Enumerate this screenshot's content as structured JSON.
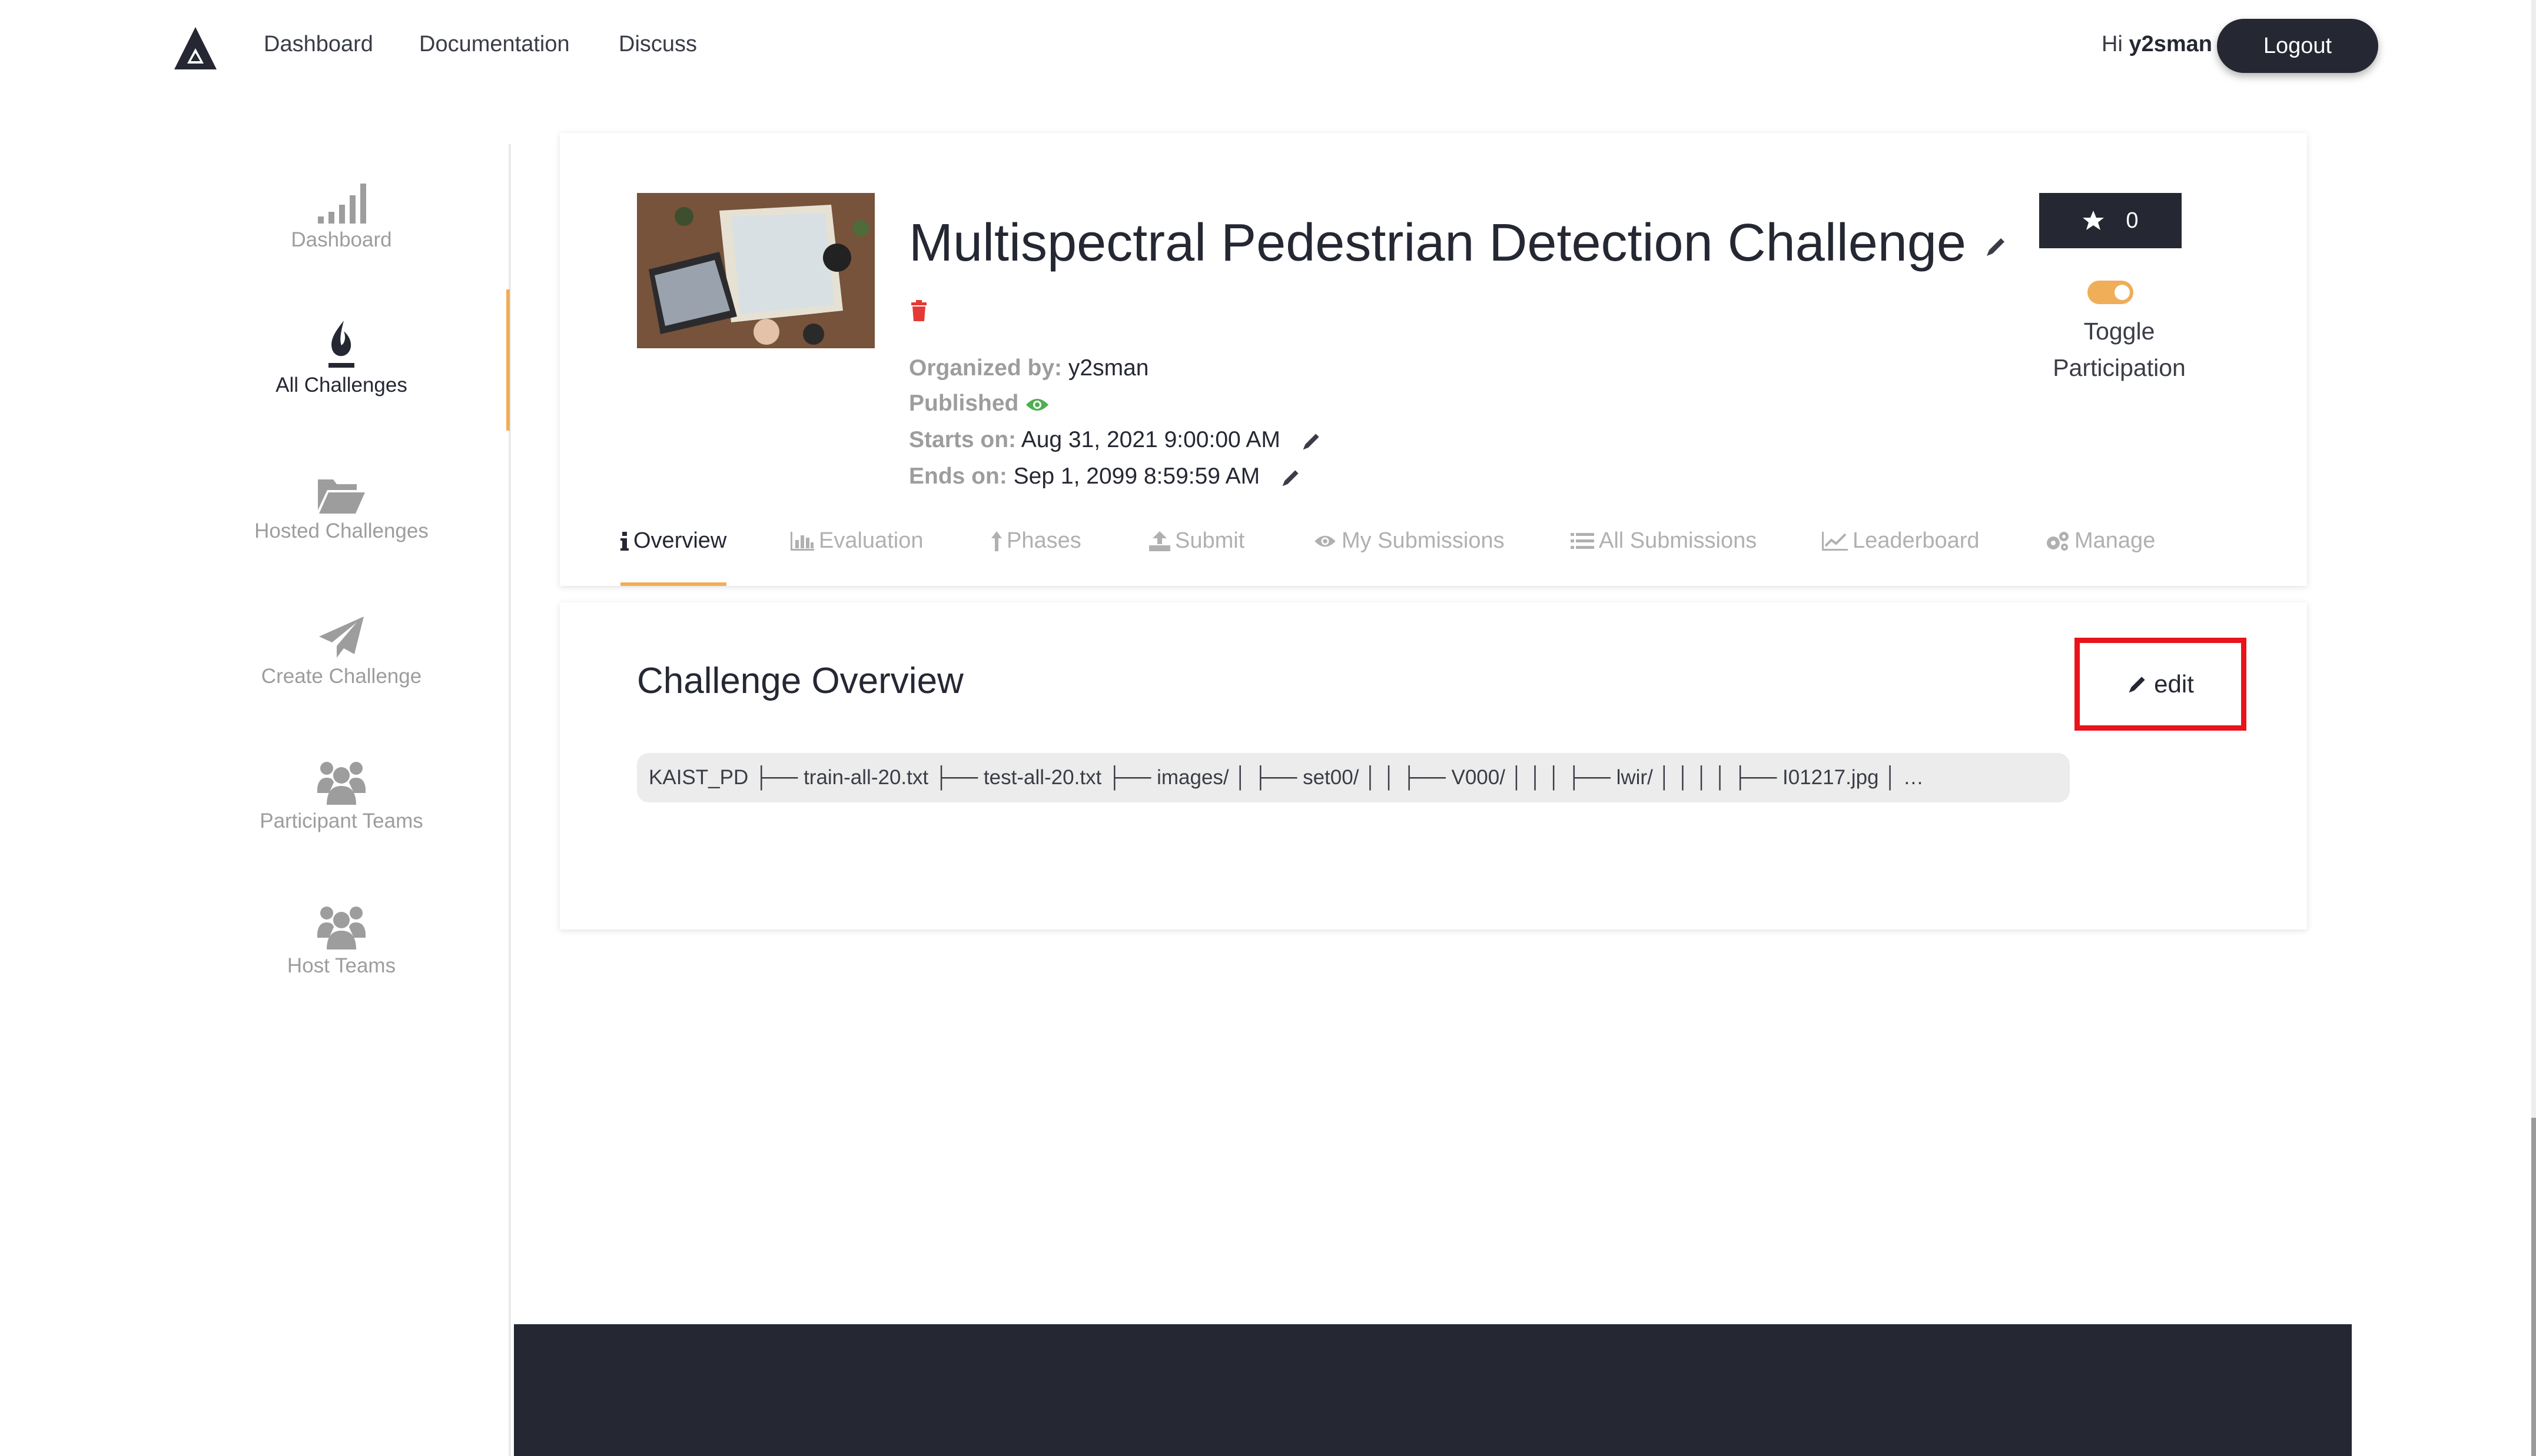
{
  "nav": {
    "links": [
      "Dashboard",
      "Documentation",
      "Discuss"
    ],
    "greeting_prefix": "Hi",
    "username": "y2sman",
    "logout_label": "Logout"
  },
  "sidebar": {
    "items": [
      {
        "label": "Dashboard",
        "icon": "bar-signal-icon",
        "active": false
      },
      {
        "label": "All Challenges",
        "icon": "flame-icon",
        "active": true
      },
      {
        "label": "Hosted Challenges",
        "icon": "folder-open-icon",
        "active": false
      },
      {
        "label": "Create Challenge",
        "icon": "paper-plane-icon",
        "active": false
      },
      {
        "label": "Participant Teams",
        "icon": "users-icon",
        "active": false
      },
      {
        "label": "Host Teams",
        "icon": "users-icon",
        "active": false
      }
    ]
  },
  "challenge": {
    "title": "Multispectral Pedestrian Detection Challenge",
    "organized_label": "Organized by:",
    "organizer": "y2sman",
    "published_label": "Published",
    "starts_label": "Starts on:",
    "starts_value": "Aug 31, 2021 9:00:00 AM",
    "ends_label": "Ends on:",
    "ends_value": "Sep 1, 2099 8:59:59 AM",
    "star_count": "0",
    "toggle_label_line1": "Toggle",
    "toggle_label_line2": "Participation"
  },
  "tabs": [
    "Overview",
    "Evaluation",
    "Phases",
    "Submit",
    "My Submissions",
    "All Submissions",
    "Leaderboard",
    "Manage"
  ],
  "overview": {
    "heading": "Challenge Overview",
    "edit_label": "edit",
    "code_text": "KAIST_PD  ├── train-all-20.txt  ├── test-all-20.txt  ├── images/  │   ├── set00/  │   │   ├── V000/  │   │   │   ├── lwir/  │   │   │   │   ├── I01217.jpg  │  …"
  },
  "colors": {
    "accent": "#f0ae58",
    "dark": "#252833",
    "muted": "#9d9d9d",
    "highlight_box": "#e8131b",
    "published_eye": "#4caf50",
    "delete_icon": "#e53935"
  }
}
